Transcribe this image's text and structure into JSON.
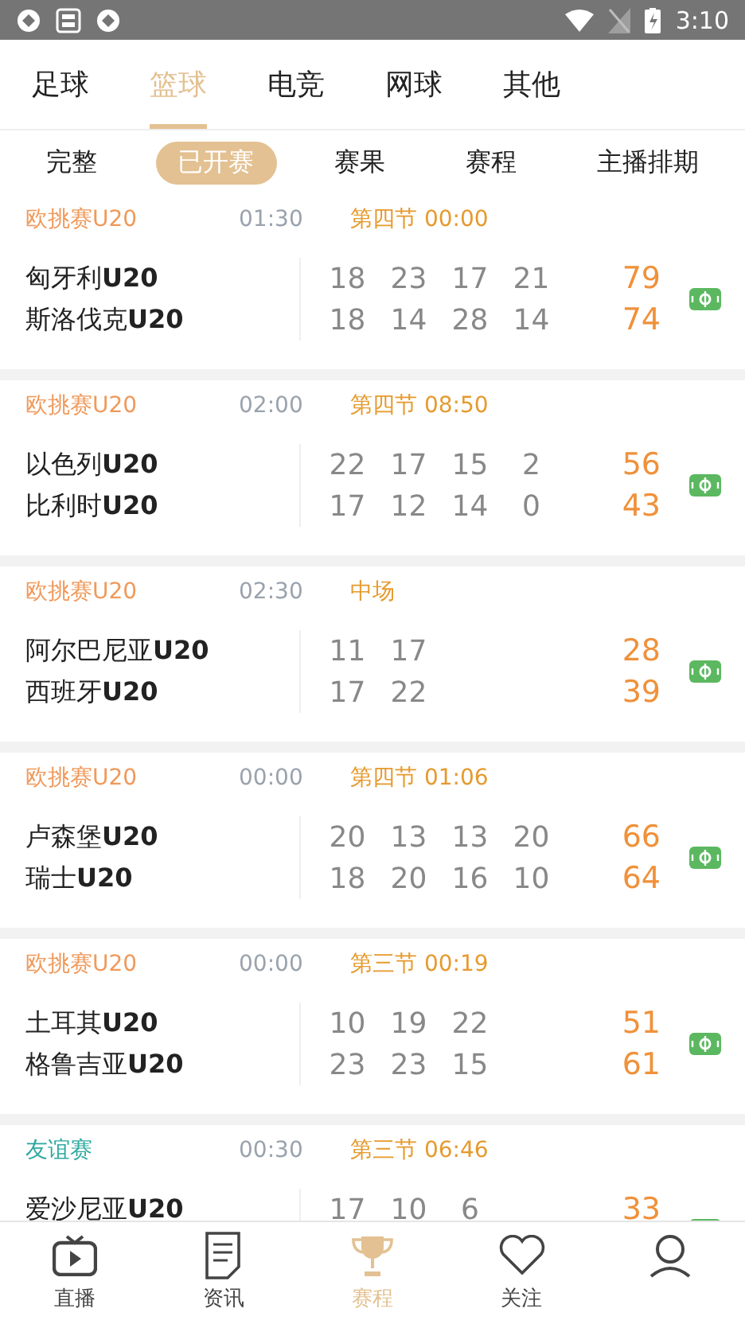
{
  "status_bar": {
    "time": "3:10"
  },
  "sport_tabs": [
    {
      "label": "足球",
      "selected": false
    },
    {
      "label": "篮球",
      "selected": true
    },
    {
      "label": "电竞",
      "selected": false
    },
    {
      "label": "网球",
      "selected": false
    },
    {
      "label": "其他",
      "selected": false
    }
  ],
  "filter_tabs": [
    {
      "label": "完整",
      "selected": false
    },
    {
      "label": "已开赛",
      "selected": true
    },
    {
      "label": "赛果",
      "selected": false
    },
    {
      "label": "赛程",
      "selected": false
    },
    {
      "label": "主播排期",
      "selected": false
    }
  ],
  "matches": [
    {
      "league": "欧挑赛U20",
      "color": "#f0995a",
      "time": "01:30",
      "status": "第四节 00:00",
      "teams": [
        {
          "name": "匈牙利**U20**",
          "quarters": [
            "18",
            "23",
            "17",
            "21"
          ],
          "total": "79"
        },
        {
          "name": "斯洛伐克**U20**",
          "quarters": [
            "18",
            "14",
            "28",
            "14"
          ],
          "total": "74"
        }
      ]
    },
    {
      "league": "欧挑赛U20",
      "color": "#f0995a",
      "time": "02:00",
      "status": "第四节 08:50",
      "teams": [
        {
          "name": "以色列**U20**",
          "quarters": [
            "22",
            "17",
            "15",
            "2"
          ],
          "total": "56"
        },
        {
          "name": "比利时**U20**",
          "quarters": [
            "17",
            "12",
            "14",
            "0"
          ],
          "total": "43"
        }
      ]
    },
    {
      "league": "欧挑赛U20",
      "color": "#f0995a",
      "time": "02:30",
      "status": "中场",
      "teams": [
        {
          "name": "阿尔巴尼亚**U20**",
          "quarters": [
            "11",
            "17"
          ],
          "total": "28"
        },
        {
          "name": "西班牙**U20**",
          "quarters": [
            "17",
            "22"
          ],
          "total": "39"
        }
      ]
    },
    {
      "league": "欧挑赛U20",
      "color": "#f0995a",
      "time": "00:00",
      "status": "第四节 01:06",
      "teams": [
        {
          "name": "卢森堡**U20**",
          "quarters": [
            "20",
            "13",
            "13",
            "20"
          ],
          "total": "66"
        },
        {
          "name": "瑞士**U20**",
          "quarters": [
            "18",
            "20",
            "16",
            "10"
          ],
          "total": "64"
        }
      ]
    },
    {
      "league": "欧挑赛U20",
      "color": "#f0995a",
      "time": "00:00",
      "status": "第三节 00:19",
      "teams": [
        {
          "name": "土耳其**U20**",
          "quarters": [
            "10",
            "19",
            "22"
          ],
          "total": "51"
        },
        {
          "name": "格鲁吉亚**U20**",
          "quarters": [
            "23",
            "23",
            "15"
          ],
          "total": "61"
        }
      ]
    },
    {
      "league": "友谊赛",
      "color": "#2fa9a0",
      "time": "00:30",
      "status": "第三节 06:46",
      "teams": [
        {
          "name": "爱沙尼亚**U20**",
          "quarters": [
            "17",
            "10",
            "6"
          ],
          "total": "33"
        }
      ]
    }
  ],
  "bottom_nav": [
    {
      "label": "直播",
      "kind": "tv",
      "selected": false
    },
    {
      "label": "资讯",
      "kind": "news",
      "selected": false
    },
    {
      "label": "赛程",
      "kind": "trophy",
      "selected": true
    },
    {
      "label": "关注",
      "kind": "heart",
      "selected": false
    },
    {
      "kind": "person",
      "selected": false
    }
  ]
}
